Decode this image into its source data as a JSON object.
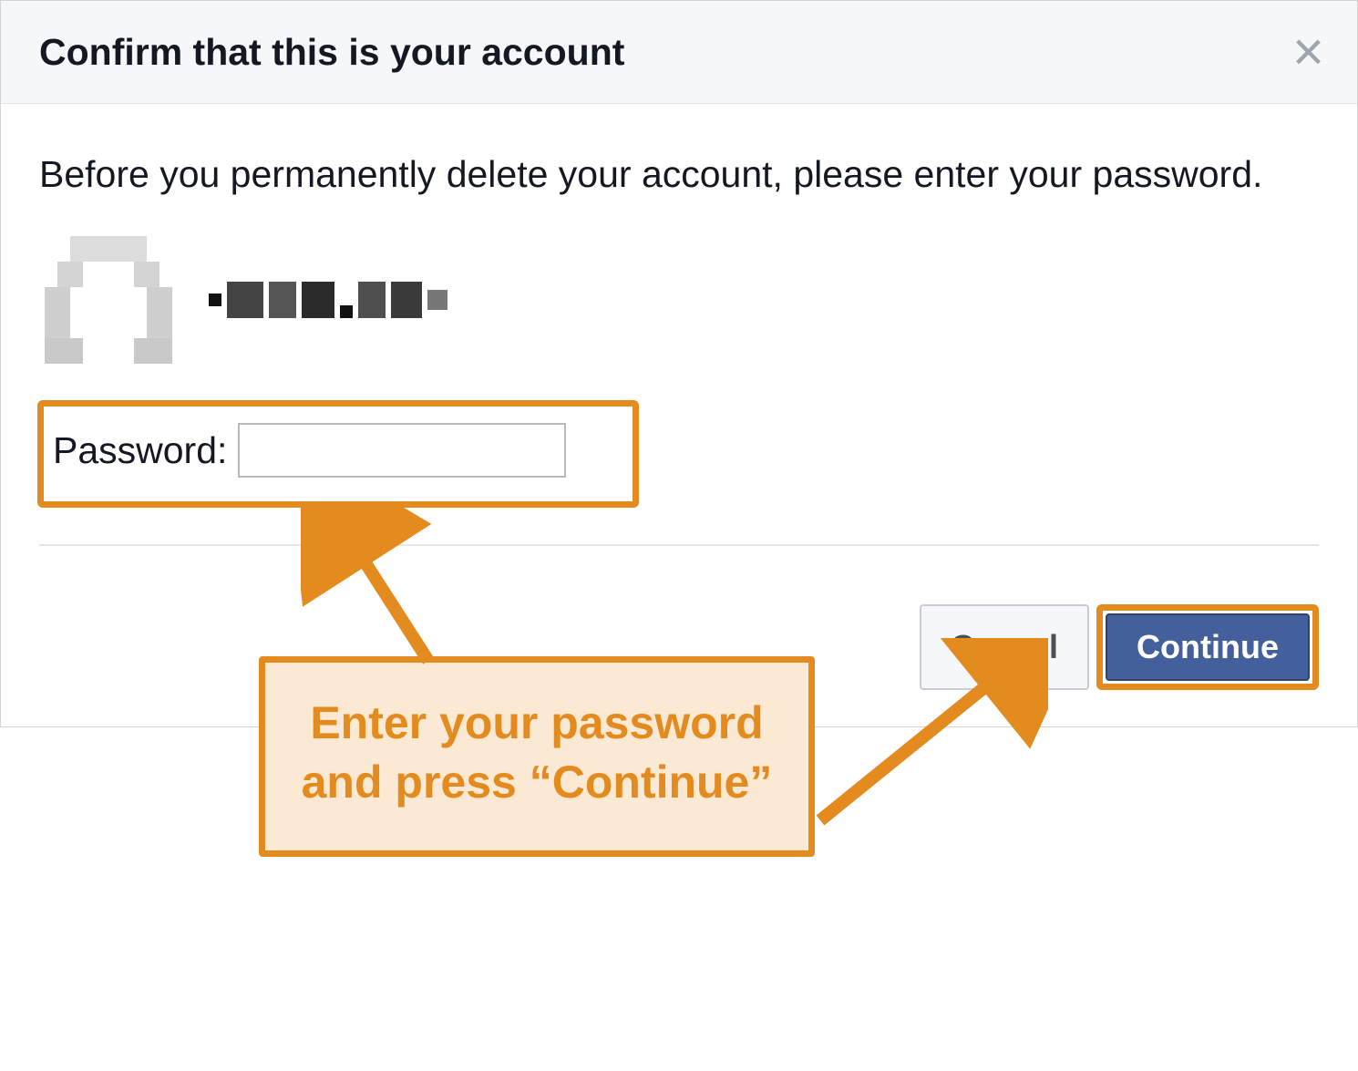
{
  "dialog": {
    "title": "Confirm that this is your account",
    "instruction": "Before you permanently delete your account, please enter your password.",
    "password_label": "Password:",
    "password_value": "",
    "cancel_label": "Cancel",
    "continue_label": "Continue"
  },
  "annotation": {
    "callout_text": "Enter your password and press “Continue”",
    "highlight_color": "#e38b1e"
  }
}
